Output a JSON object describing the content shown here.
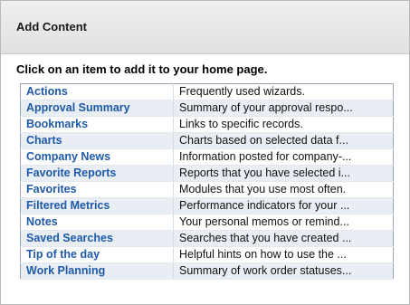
{
  "panel": {
    "title": "Add Content",
    "instruction": "Click on an item to add it to your home page."
  },
  "items": [
    {
      "name": "Actions",
      "description": "Frequently used wizards."
    },
    {
      "name": "Approval Summary",
      "description": "Summary of your approval respo..."
    },
    {
      "name": "Bookmarks",
      "description": "Links to specific records."
    },
    {
      "name": "Charts",
      "description": "Charts based on selected data f..."
    },
    {
      "name": "Company News",
      "description": "Information posted for company-..."
    },
    {
      "name": "Favorite Reports",
      "description": "Reports that you have selected i..."
    },
    {
      "name": "Favorites",
      "description": "Modules that you use most often."
    },
    {
      "name": "Filtered Metrics",
      "description": "Performance indicators for your ..."
    },
    {
      "name": "Notes",
      "description": "Your personal memos or remind..."
    },
    {
      "name": "Saved Searches",
      "description": "Searches that you have created ..."
    },
    {
      "name": "Tip of the day",
      "description": "Helpful hints on how to use the ..."
    },
    {
      "name": "Work Planning",
      "description": "Summary of work order statuses..."
    }
  ]
}
